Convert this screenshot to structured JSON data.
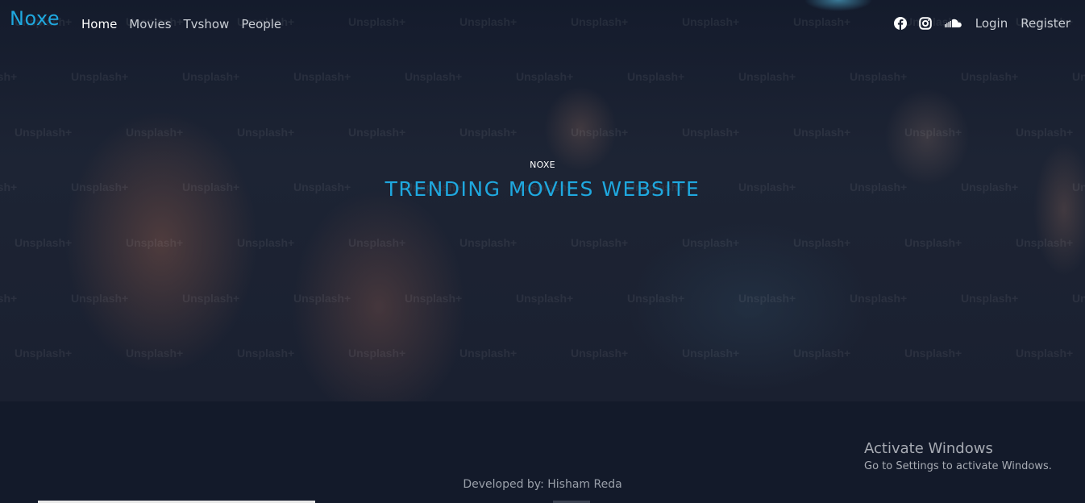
{
  "navbar": {
    "brand": "Noxe",
    "links": [
      {
        "label": "Home",
        "active": true
      },
      {
        "label": "Movies",
        "active": false
      },
      {
        "label": "Tvshow",
        "active": false
      },
      {
        "label": "People",
        "active": false
      }
    ],
    "social_icons": [
      "facebook-icon",
      "instagram-icon",
      "soundcloud-icon"
    ],
    "login_label": "Login",
    "register_label": "Register"
  },
  "hero": {
    "eyebrow": "NOXE",
    "headline": "TRENDING MOVIES WEBSITE",
    "watermark_text": "Unsplash+"
  },
  "footer": {
    "credit": "Developed by: Hisham Reda"
  },
  "os_overlay": {
    "title": "Activate Windows",
    "subtitle": "Go to Settings to activate Windows."
  },
  "colors": {
    "accent": "#1fa8df",
    "background": "#131a2a",
    "nav_text": "#c9cdd4"
  }
}
